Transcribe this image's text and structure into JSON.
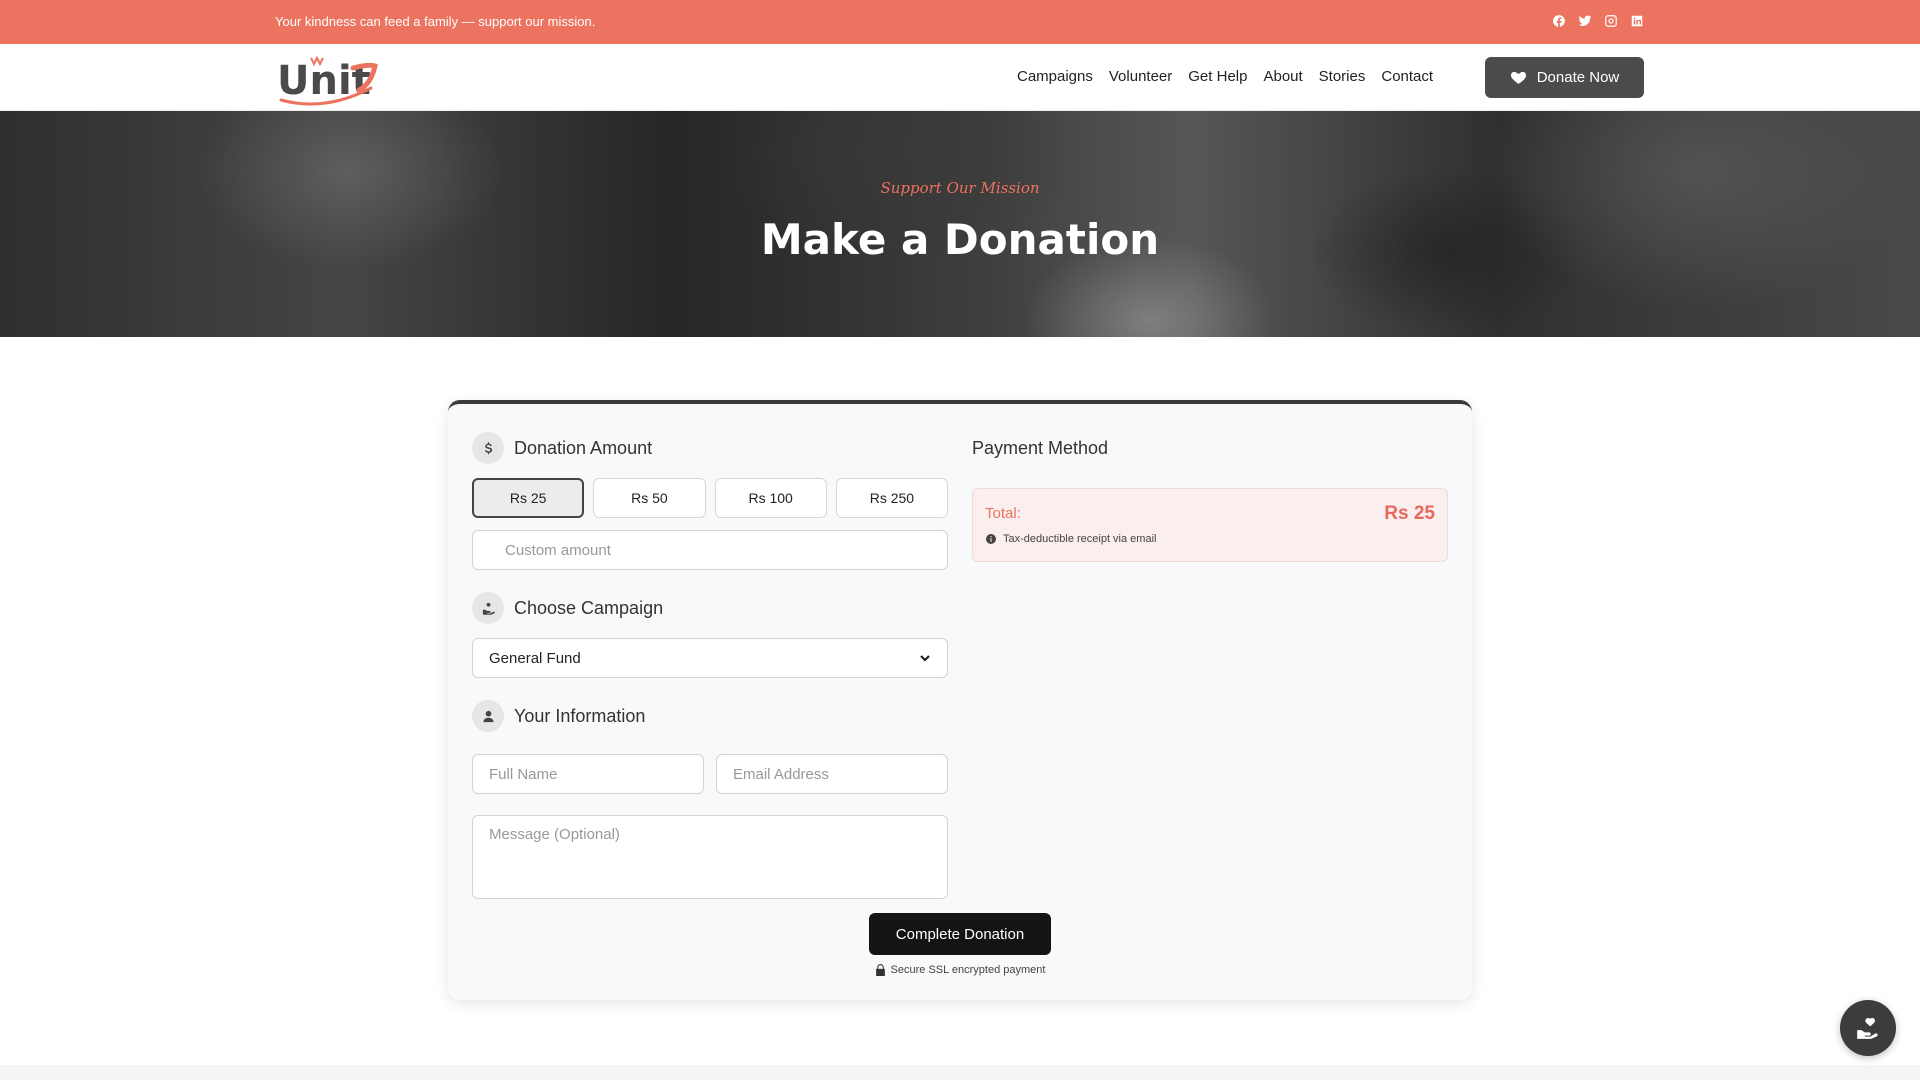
{
  "topbar": {
    "tagline": "Your kindness can feed a family — support our mission.",
    "socials": [
      "facebook-icon",
      "twitter-icon",
      "instagram-icon",
      "linkedin-icon"
    ],
    "background_color": "#ec735f"
  },
  "nav": {
    "logo_text": "Unity",
    "links": [
      "Campaigns",
      "Volunteer",
      "Get Help",
      "About",
      "Stories",
      "Contact"
    ],
    "donate_label": "Donate Now"
  },
  "hero": {
    "eyebrow": "Support Our Mission",
    "title": "Make a Donation"
  },
  "donation": {
    "amount_title": "Donation Amount",
    "amounts": [
      "Rs 25",
      "Rs 50",
      "Rs 100",
      "Rs 250"
    ],
    "selected_amount": "Rs 25",
    "custom_placeholder": "Custom amount",
    "campaign_title": "Choose Campaign",
    "campaign_selected": "General Fund",
    "info_title": "Your Information",
    "full_name_placeholder": "Full Name",
    "email_placeholder": "Email Address",
    "message_placeholder": "Message (Optional)"
  },
  "payment": {
    "title": "Payment Method",
    "total_label": "Total:",
    "total_value": "Rs 25",
    "receipt_note": "Tax-deductible receipt via email"
  },
  "actions": {
    "complete_label": "Complete Donation",
    "secure_note": "Secure SSL encrypted payment"
  },
  "colors": {
    "accent": "#ec735f",
    "dark_button": "#141414"
  }
}
